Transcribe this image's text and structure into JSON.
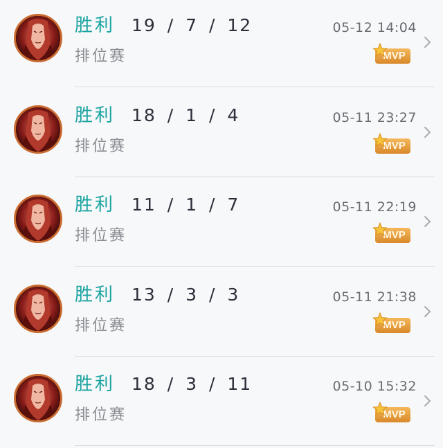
{
  "matches": [
    {
      "result": "胜利",
      "kda": "19 / 7 / 12",
      "mode": "排位赛",
      "time": "05-12 14:04",
      "badge": "MVP"
    },
    {
      "result": "胜利",
      "kda": "18 / 1 / 4",
      "mode": "排位赛",
      "time": "05-11 23:27",
      "badge": "MVP"
    },
    {
      "result": "胜利",
      "kda": "11 / 1 / 7",
      "mode": "排位赛",
      "time": "05-11 22:19",
      "badge": "MVP"
    },
    {
      "result": "胜利",
      "kda": "13 / 3 / 3",
      "mode": "排位赛",
      "time": "05-11 21:38",
      "badge": "MVP"
    },
    {
      "result": "胜利",
      "kda": "18 / 3 / 11",
      "mode": "排位赛",
      "time": "05-10 15:32",
      "badge": "MVP"
    }
  ],
  "colors": {
    "result": "#1aa3a0",
    "kda": "#2e2e3a",
    "mode": "#8a8c92",
    "time": "#6a6c72",
    "mvp_badge": "#e29a3a",
    "avatar_ring": "#c96a2f"
  },
  "icons": {
    "avatar": "hero-portrait-icon",
    "mvp_star": "star-icon",
    "row_arrow": "chevron-right-icon"
  }
}
